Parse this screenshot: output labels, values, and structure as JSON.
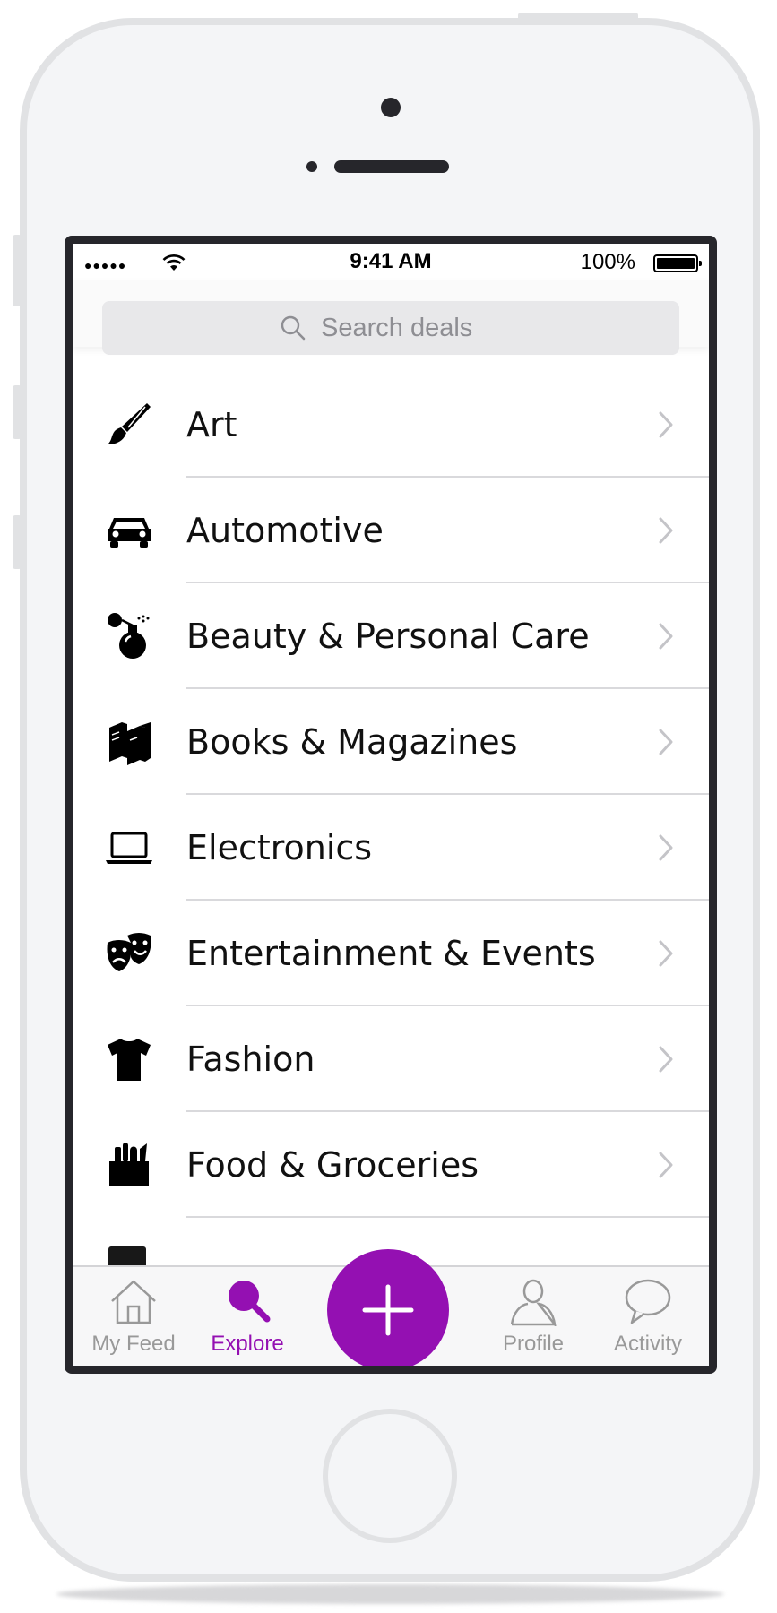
{
  "status_bar": {
    "signal": "●●●●●",
    "time": "9:41 AM",
    "battery": "100%"
  },
  "search": {
    "placeholder": "Search deals"
  },
  "categories": [
    {
      "label": "Art",
      "icon": "paintbrush-icon"
    },
    {
      "label": "Automotive",
      "icon": "car-icon"
    },
    {
      "label": "Beauty & Personal Care",
      "icon": "perfume-icon"
    },
    {
      "label": "Books & Magazines",
      "icon": "books-icon"
    },
    {
      "label": "Electronics",
      "icon": "laptop-icon"
    },
    {
      "label": "Entertainment & Events",
      "icon": "theater-masks-icon"
    },
    {
      "label": "Fashion",
      "icon": "tshirt-icon"
    },
    {
      "label": "Food & Groceries",
      "icon": "grocery-bag-icon"
    }
  ],
  "tab_bar": {
    "tabs": [
      {
        "label": "My Feed",
        "icon": "home-icon",
        "active": false
      },
      {
        "label": "Explore",
        "icon": "search-icon",
        "active": true
      },
      {
        "label": "Profile",
        "icon": "person-icon",
        "active": false
      },
      {
        "label": "Activity",
        "icon": "chat-bubble-icon",
        "active": false
      }
    ],
    "center_action": "plus-icon"
  },
  "colors": {
    "accent": "#9410b2",
    "inactive": "#999999",
    "separator": "#d9d9dc"
  }
}
